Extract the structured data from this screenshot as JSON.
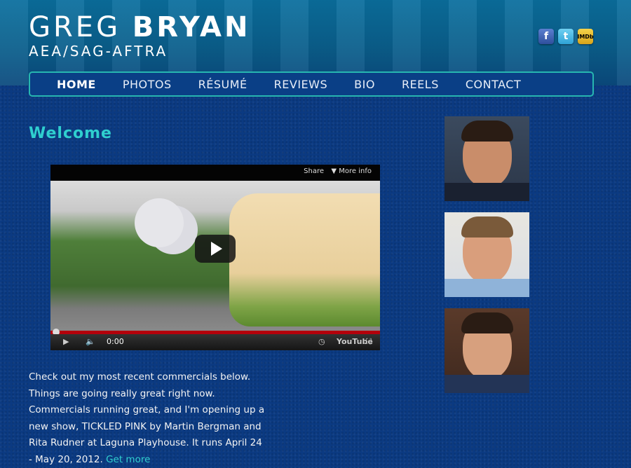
{
  "header": {
    "first_name": "GREG",
    "last_name": "BRYAN",
    "union": "AEA/SAG-AFTRA"
  },
  "social": [
    {
      "icon": "facebook-icon",
      "glyph": "f"
    },
    {
      "icon": "twitter-icon",
      "glyph": "t"
    },
    {
      "icon": "imdb-icon",
      "glyph": "IMDb"
    }
  ],
  "nav": {
    "items": [
      "HOME",
      "PHOTOS",
      "RÉSUMÉ",
      "REVIEWS",
      "BIO",
      "REELS",
      "CONTACT"
    ],
    "active": "HOME"
  },
  "main": {
    "heading": "Welcome",
    "video": {
      "share_label": "Share",
      "more_info_label": "More info",
      "time": "0:00",
      "provider": "YouTube"
    },
    "body_text": "Check out my most recent commercials below. Things are going really great right now. Commercials running great, and I'm opening up a new show, TICKLED PINK by Martin Bergman and Rita Rudner at Laguna Playhouse. It runs April 24 - May 20, 2012.",
    "link_text": "Get more"
  },
  "colors": {
    "accent": "#2fcfcf",
    "background": "#0b3a82",
    "nav_border": "#27b6b0"
  }
}
